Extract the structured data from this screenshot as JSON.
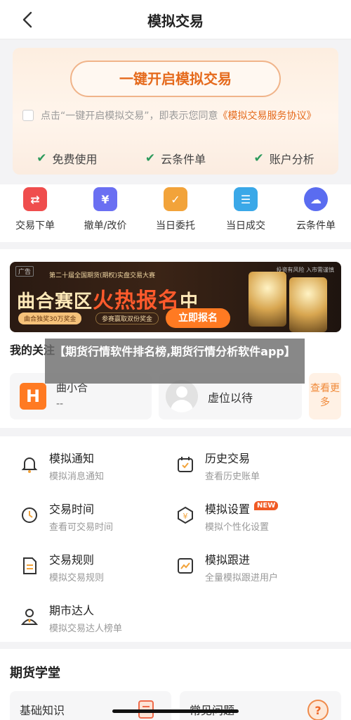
{
  "header": {
    "title": "模拟交易"
  },
  "promo": {
    "button_label": "一键开启模拟交易",
    "agree_prefix": "点击“一键开启模拟交易”，即表示您同意",
    "agree_link": "《模拟交易服务协议》",
    "features": [
      "免费使用",
      "云条件单",
      "账户分析"
    ]
  },
  "quick_actions": [
    {
      "label": "交易下单",
      "icon": "order-icon",
      "color": "#ef4d4d"
    },
    {
      "label": "撤单/改价",
      "icon": "cancel-price-icon",
      "color": "#6a6ff2"
    },
    {
      "label": "当日委托",
      "icon": "entrust-icon",
      "color": "#f2a33a"
    },
    {
      "label": "当日成交",
      "icon": "deal-icon",
      "color": "#3aa8e8"
    },
    {
      "label": "云条件单",
      "icon": "cloud-icon",
      "color": "#5a6cf0"
    }
  ],
  "banner": {
    "ad_tag": "广告",
    "risk_text": "投资有风险 入市需谨慎",
    "small_title": "第二十届全国期货(期权)实盘交易大赛",
    "main_title_a": "曲合赛区",
    "main_title_b": "火热报名",
    "main_title_c": "中",
    "sub1": "曲合独奖30万奖金",
    "sub2": "参赛赢取双份奖金",
    "cta": "立即报名"
  },
  "follow": {
    "title": "我的关注",
    "card1_name": "曲小合",
    "card1_value": "--",
    "card2_name": "虚位以待",
    "see_more": "查看更多"
  },
  "overlay": {
    "text": "【期货行情软件排名榜,期货行情分析软件app】"
  },
  "tools": [
    {
      "name": "模拟通知",
      "desc": "模拟消息通知",
      "icon": "bell-icon"
    },
    {
      "name": "历史交易",
      "desc": "查看历史账单",
      "icon": "calendar-icon"
    },
    {
      "name": "交易时间",
      "desc": "查看可交易时间",
      "icon": "clock-icon"
    },
    {
      "name": "模拟设置",
      "desc": "模拟个性化设置",
      "icon": "settings-icon",
      "badge": "NEW"
    },
    {
      "name": "交易规则",
      "desc": "模拟交易规则",
      "icon": "rules-doc-icon"
    },
    {
      "name": "模拟跟进",
      "desc": "全量模拟跟进用户",
      "icon": "trend-chart-icon"
    },
    {
      "name": "期市达人",
      "desc": "模拟交易达人榜单",
      "icon": "expert-icon"
    }
  ],
  "school": {
    "title": "期货学堂",
    "card1": "基础知识",
    "card2": "常见问题"
  },
  "colors": {
    "accent": "#e56a1c",
    "check": "#2c9a5c"
  }
}
